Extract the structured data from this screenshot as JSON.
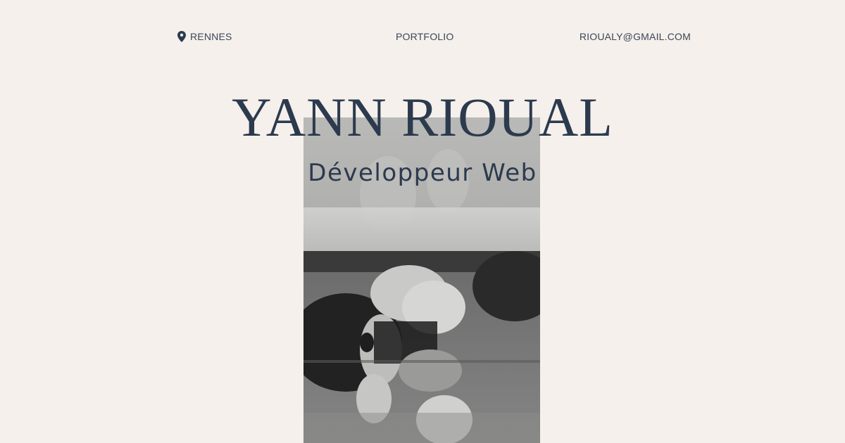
{
  "nav": {
    "location": "RENNES",
    "location_icon": "map-pin-icon",
    "portfolio": "PORTFOLIO",
    "email": "RIOUALY@GMAIL.COM"
  },
  "hero": {
    "name": "YANN RIOUAL",
    "role": "Développeur Web"
  },
  "colors": {
    "background": "#f5f0eb",
    "text": "#2c3a4e"
  }
}
